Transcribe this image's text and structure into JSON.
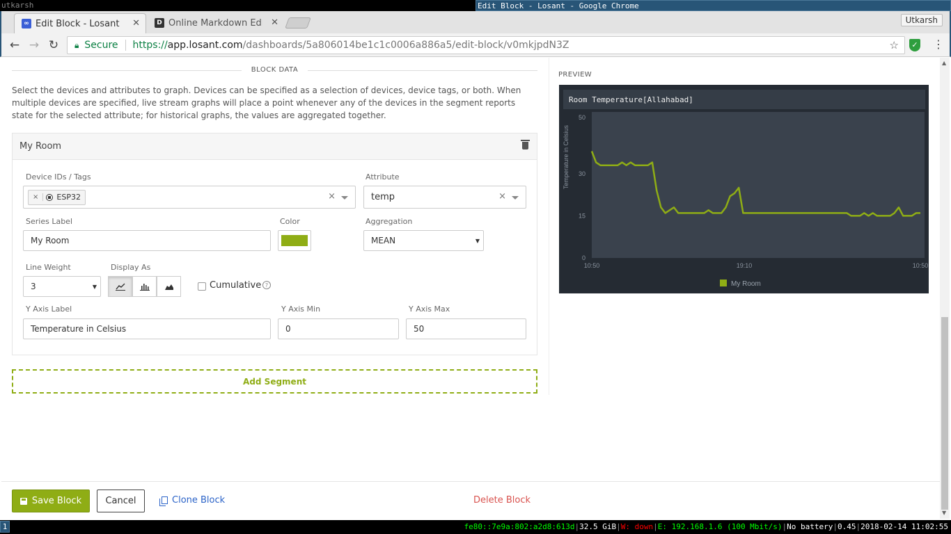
{
  "wm": {
    "workspace_name": "utkarsh",
    "window_title": "Edit Block - Losant - Google Chrome",
    "workspace_number": "1",
    "status": {
      "ipv6": "fe80::7e9a:802:a2d8:613d",
      "disk": "32.5 GiB",
      "wifi": "W: down",
      "ethernet": "E: 192.168.1.6 (100 Mbit/s)",
      "battery": "No battery",
      "load": "0.45",
      "datetime": "2018-02-14 11:02:55"
    }
  },
  "browser": {
    "tabs": [
      {
        "title": "Edit Block - Losant",
        "favicon_letter": "∞",
        "active": true
      },
      {
        "title": "Online Markdown Editor",
        "favicon_letter": "D",
        "active": false
      }
    ],
    "profile_name": "Utkarsh",
    "secure_label": "Secure",
    "url_scheme": "https://",
    "url_host": "app.losant.com",
    "url_path": "/dashboards/5a806014be1c1c0006a886a5/edit-block/v0mkjpdN3Z"
  },
  "editor": {
    "section_title": "BLOCK DATA",
    "description": "Select the devices and attributes to graph. Devices can be specified as a selection of devices, device tags, or both. When multiple devices are specified, live stream graphs will place a point whenever any of the devices in the segment reports state for the selected attribute; for historical graphs, the values are aggregated together.",
    "segment": {
      "name": "My Room",
      "device_label": "Device IDs / Tags",
      "device_chip": "ESP32",
      "attribute_label": "Attribute",
      "attribute_value": "temp",
      "series_label_label": "Series Label",
      "series_label_value": "My Room",
      "color_label": "Color",
      "color_value": "#8fad15",
      "aggregation_label": "Aggregation",
      "aggregation_value": "MEAN",
      "line_weight_label": "Line Weight",
      "line_weight_value": "3",
      "display_as_label": "Display As",
      "display_as_options": [
        "line",
        "bar",
        "area"
      ],
      "display_as_selected": "line",
      "cumulative_label": "Cumulative",
      "cumulative_checked": false,
      "y_axis_label_label": "Y Axis Label",
      "y_axis_label_value": "Temperature in Celsius",
      "y_axis_min_label": "Y Axis Min",
      "y_axis_min_value": "0",
      "y_axis_max_label": "Y Axis Max",
      "y_axis_max_value": "50"
    },
    "add_segment_label": "Add Segment"
  },
  "preview": {
    "label": "PREVIEW",
    "title": "Room Temperature[Allahabad]"
  },
  "chart_data": {
    "type": "line",
    "title": "Room Temperature[Allahabad]",
    "ylabel": "Temperature in Celsius",
    "ylim": [
      0,
      50
    ],
    "yticks": [
      0,
      15,
      30,
      50
    ],
    "xticks": [
      "10:50",
      "19:10",
      "10:50"
    ],
    "legend_placement": "bottom-center",
    "series": [
      {
        "name": "My Room",
        "color": "#8fad15",
        "values": [
          38,
          34,
          33,
          33,
          33,
          33,
          33,
          34,
          33,
          34,
          33,
          33,
          33,
          33,
          34,
          24,
          18,
          16,
          17,
          18,
          16,
          16,
          16,
          16,
          16,
          16,
          16,
          17,
          16,
          16,
          16,
          18,
          22,
          23,
          25,
          16,
          16,
          16,
          16,
          16,
          16,
          16,
          16,
          16,
          16,
          16,
          16,
          16,
          16,
          16,
          16,
          16,
          16,
          16,
          16,
          16,
          16,
          16,
          16,
          16,
          15,
          15,
          15,
          16,
          15,
          16,
          15,
          15,
          15,
          15,
          16,
          18,
          15,
          15,
          15,
          16,
          16
        ]
      }
    ]
  },
  "footer": {
    "save_label": "Save Block",
    "cancel_label": "Cancel",
    "clone_label": "Clone Block",
    "delete_label": "Delete Block"
  }
}
